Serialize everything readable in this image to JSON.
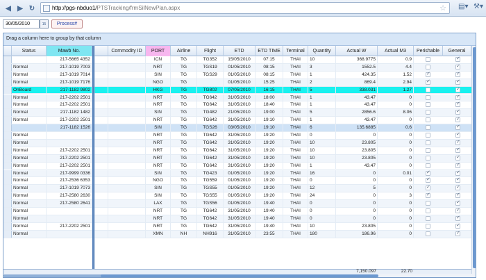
{
  "browser": {
    "url_host": "http://pgs-nbduo1/",
    "url_path": "PTSTracking/frmSilNewPlan.aspx",
    "back_icon": "arrow-left-icon",
    "forward_icon": "arrow-right-icon"
  },
  "toolbar": {
    "date_value": "30/05/2010",
    "process_label": "Process#"
  },
  "grid": {
    "group_hint": "Drag a column here to group by that column",
    "columns": [
      "Status",
      "Mawb No.",
      "",
      "Commodity ID",
      "PORT",
      "Airline",
      "Flight",
      "ETD",
      "ETD TIME",
      "Terminal",
      "Quantity",
      "Actual W",
      "Actual M3",
      "Perishable",
      "General"
    ],
    "rows": [
      {
        "status": "",
        "mawb": "217-5665 4352",
        "port": "ICN",
        "airline": "TG",
        "flight": "TG352",
        "etd": "15/05/2010",
        "time": "07:15",
        "terminal": "THAI",
        "qty": "10",
        "aw": "368.9775",
        "am3": "0.9",
        "per": false,
        "gen": true
      },
      {
        "status": "Normal",
        "mawb": "217-1019 7003",
        "port": "NRT",
        "airline": "TG",
        "flight": "TGS19",
        "etd": "01/05/2010",
        "time": "08:15",
        "terminal": "THAI",
        "qty": "3",
        "aw": "1552.5",
        "am3": "4.4",
        "per": false,
        "gen": true
      },
      {
        "status": "Normal",
        "mawb": "217-1019 7014",
        "port": "SIN",
        "airline": "TG",
        "flight": "TGS29",
        "etd": "01/05/2010",
        "time": "08:15",
        "terminal": "THAI",
        "qty": "1",
        "aw": "424.35",
        "am3": "1.52",
        "per": true,
        "gen": true
      },
      {
        "status": "Normal",
        "mawb": "217-1019 7176",
        "port": "NGO",
        "airline": "TG",
        "flight": "",
        "etd": "01/05/2010",
        "time": "15:25",
        "terminal": "THAI",
        "qty": "2",
        "aw": "869.4",
        "am3": "2.94",
        "per": true,
        "gen": true
      },
      {
        "status": "OnBoard",
        "mawb": "217-1182 9802",
        "port": "HKG",
        "airline": "TG",
        "flight": "TG802",
        "etd": "07/05/2010",
        "time": "16:15",
        "terminal": "THAI",
        "qty": "5",
        "aw": "338.031",
        "am3": "1.27",
        "per": false,
        "gen": true
      },
      {
        "status": "Normal",
        "mawb": "217-2202 2501",
        "port": "NRT",
        "airline": "TG",
        "flight": "TG642",
        "etd": "31/05/2010",
        "time": "18:00",
        "terminal": "THAI",
        "qty": "1",
        "aw": "43.47",
        "am3": "0",
        "per": false,
        "gen": true
      },
      {
        "status": "Normal",
        "mawb": "217-2202 2501",
        "port": "NRT",
        "airline": "TG",
        "flight": "TG642",
        "etd": "31/05/2010",
        "time": "18:40",
        "terminal": "THAI",
        "qty": "1",
        "aw": "43.47",
        "am3": "0",
        "per": false,
        "gen": true
      },
      {
        "status": "Normal",
        "mawb": "217-1182 1482",
        "port": "SIN",
        "airline": "TG",
        "flight": "TG482",
        "etd": "21/05/2010",
        "time": "19:00",
        "terminal": "THAI",
        "qty": "5",
        "aw": "2856.6",
        "am3": "8.06",
        "per": false,
        "gen": true
      },
      {
        "status": "Normal",
        "mawb": "217-2202 2501",
        "port": "NRT",
        "airline": "TG",
        "flight": "TG642",
        "etd": "31/05/2010",
        "time": "19:10",
        "terminal": "THAI",
        "qty": "1",
        "aw": "43.47",
        "am3": "0",
        "per": false,
        "gen": true
      },
      {
        "status": "",
        "mawb": "217-1182 1526",
        "port": "SIN",
        "airline": "TG",
        "flight": "TGS26",
        "etd": "03/05/2010",
        "time": "19:10",
        "terminal": "THAI",
        "qty": "6",
        "aw": "135.6885",
        "am3": "0.6",
        "per": false,
        "gen": true
      },
      {
        "status": "Normal",
        "mawb": "",
        "port": "NRT",
        "airline": "TG",
        "flight": "TG642",
        "etd": "31/05/2010",
        "time": "19:20",
        "terminal": "THAI",
        "qty": "0",
        "aw": "0",
        "am3": "0",
        "per": false,
        "gen": true
      },
      {
        "status": "Normal",
        "mawb": "",
        "port": "NRT",
        "airline": "TG",
        "flight": "TG642",
        "etd": "31/05/2010",
        "time": "19:20",
        "terminal": "THAI",
        "qty": "10",
        "aw": "23.805",
        "am3": "0",
        "per": false,
        "gen": true
      },
      {
        "status": "Normal",
        "mawb": "217-2202 2501",
        "port": "NRT",
        "airline": "TG",
        "flight": "TG642",
        "etd": "31/05/2010",
        "time": "19:20",
        "terminal": "THAI",
        "qty": "10",
        "aw": "23.805",
        "am3": "0",
        "per": false,
        "gen": true
      },
      {
        "status": "Normal",
        "mawb": "217-2202 2501",
        "port": "NRT",
        "airline": "TG",
        "flight": "TG642",
        "etd": "31/05/2010",
        "time": "19:20",
        "terminal": "THAI",
        "qty": "10",
        "aw": "23.805",
        "am3": "0",
        "per": false,
        "gen": true
      },
      {
        "status": "Normal",
        "mawb": "217-2202 2501",
        "port": "NRT",
        "airline": "TG",
        "flight": "TG642",
        "etd": "31/05/2010",
        "time": "19:20",
        "terminal": "THAI",
        "qty": "1",
        "aw": "43.47",
        "am3": "0",
        "per": false,
        "gen": true
      },
      {
        "status": "Normal",
        "mawb": "217-9999 0336",
        "port": "SIN",
        "airline": "TG",
        "flight": "TG423",
        "etd": "01/05/2010",
        "time": "19:20",
        "terminal": "THAI",
        "qty": "16",
        "aw": "0",
        "am3": "0.01",
        "per": true,
        "gen": true
      },
      {
        "status": "Normal",
        "mawb": "217-2536 6353",
        "port": "NGO",
        "airline": "TG",
        "flight": "TG559",
        "etd": "01/05/2010",
        "time": "19:20",
        "terminal": "THAI",
        "qty": "0",
        "aw": "0",
        "am3": "0",
        "per": true,
        "gen": true
      },
      {
        "status": "Normal",
        "mawb": "217-1019 7073",
        "port": "SIN",
        "airline": "TG",
        "flight": "TGS55",
        "etd": "01/05/2010",
        "time": "19:20",
        "terminal": "THAI",
        "qty": "12",
        "aw": "5",
        "am3": "0",
        "per": true,
        "gen": true
      },
      {
        "status": "Normal",
        "mawb": "217-2580 2630",
        "port": "SIN",
        "airline": "TG",
        "flight": "TGS55",
        "etd": "01/05/2010",
        "time": "19:20",
        "terminal": "THAI",
        "qty": "24",
        "aw": "0",
        "am3": "3",
        "per": true,
        "gen": true
      },
      {
        "status": "Normal",
        "mawb": "217-2580 2641",
        "port": "LAX",
        "airline": "TG",
        "flight": "TGS56",
        "etd": "01/05/2010",
        "time": "19:40",
        "terminal": "THAI",
        "qty": "0",
        "aw": "0",
        "am3": "0",
        "per": false,
        "gen": true
      },
      {
        "status": "Normal",
        "mawb": "",
        "port": "NRT",
        "airline": "TG",
        "flight": "TG642",
        "etd": "31/05/2010",
        "time": "19:40",
        "terminal": "THAI",
        "qty": "0",
        "aw": "0",
        "am3": "0",
        "per": false,
        "gen": true
      },
      {
        "status": "Normal",
        "mawb": "",
        "port": "NRT",
        "airline": "TG",
        "flight": "TG642",
        "etd": "31/05/2010",
        "time": "19:40",
        "terminal": "THAI",
        "qty": "0",
        "aw": "0",
        "am3": "0",
        "per": false,
        "gen": true
      },
      {
        "status": "Normal",
        "mawb": "217-2202 2501",
        "port": "NRT",
        "airline": "TG",
        "flight": "TG642",
        "etd": "31/05/2010",
        "time": "19:40",
        "terminal": "THAI",
        "qty": "10",
        "aw": "23.805",
        "am3": "0",
        "per": false,
        "gen": true
      },
      {
        "status": "Normal",
        "mawb": "",
        "port": "XMN",
        "airline": "NH",
        "flight": "NH916",
        "etd": "31/05/2010",
        "time": "23:55",
        "terminal": "THAI",
        "qty": "180",
        "aw": "186.96",
        "am3": "0",
        "per": false,
        "gen": true
      }
    ],
    "totals": {
      "actual_w": "7,150.097",
      "actual_m3": "22.70"
    }
  }
}
